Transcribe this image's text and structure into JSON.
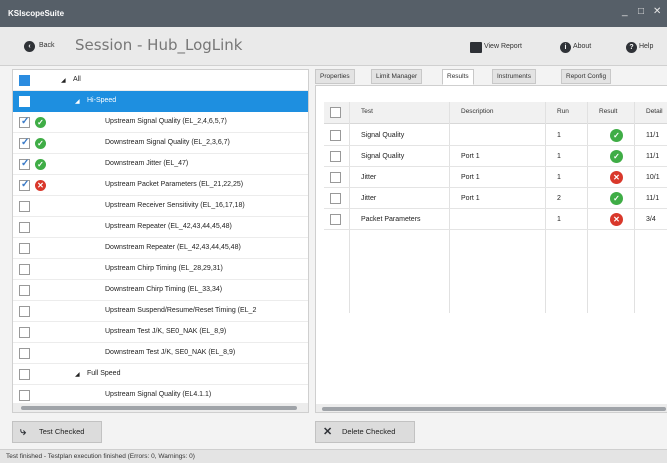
{
  "window": {
    "title": "KSIscopeSuite",
    "minimize": "_",
    "maximize": "□",
    "close": "✕"
  },
  "toolbar": {
    "back_label": "Back",
    "session_title": "Session - Hub_LogLink",
    "view_report": "View Report",
    "about": "About",
    "help": "Help"
  },
  "tree": {
    "root_label": "All",
    "group_label": "Hi-Speed",
    "items": [
      {
        "label": "Upstream Signal Quality (EL_2,4,6,5,7)",
        "checked": true,
        "status": "pass"
      },
      {
        "label": "Downstream Signal Quality (EL_2,3,6,7)",
        "checked": true,
        "status": "pass"
      },
      {
        "label": "Downstream Jitter (EL_47)",
        "checked": true,
        "status": "pass"
      },
      {
        "label": "Upstream Packet Parameters (EL_21,22,25)",
        "checked": true,
        "status": "fail"
      },
      {
        "label": "Upstream Receiver Sensitivity (EL_16,17,18)",
        "checked": false,
        "status": ""
      },
      {
        "label": "Upstream Repeater (EL_42,43,44,45,48)",
        "checked": false,
        "status": ""
      },
      {
        "label": "Downstream Repeater (EL_42,43,44,45,48)",
        "checked": false,
        "status": ""
      },
      {
        "label": "Upstream Chirp Timing (EL_28,29,31)",
        "checked": false,
        "status": ""
      },
      {
        "label": "Downstream Chirp Timing (EL_33,34)",
        "checked": false,
        "status": ""
      },
      {
        "label": "Upstream Suspend/Resume/Reset Timing (EL_2",
        "checked": false,
        "status": ""
      },
      {
        "label": "Upstream Test J/K, SE0_NAK (EL_8,9)",
        "checked": false,
        "status": ""
      },
      {
        "label": "Downstream Test J/K, SE0_NAK (EL_8,9)",
        "checked": false,
        "status": ""
      }
    ],
    "group2_label": "Full Speed",
    "group2_items": [
      {
        "label": "Upstream Signal Quality (EL4.1.1)",
        "checked": false,
        "status": ""
      }
    ]
  },
  "tabs": [
    "Properties",
    "Limit Manager",
    "Results",
    "Instruments",
    "Report Config"
  ],
  "active_tab": "Results",
  "results": {
    "columns": [
      "Test",
      "Description",
      "Run",
      "Result",
      "Detail"
    ],
    "rows": [
      {
        "test": "Signal Quality",
        "description": "",
        "run": "1",
        "result": "pass",
        "detail": "11/1"
      },
      {
        "test": "Signal Quality",
        "description": "Port 1",
        "run": "1",
        "result": "pass",
        "detail": "11/1"
      },
      {
        "test": "Jitter",
        "description": "Port 1",
        "run": "1",
        "result": "fail",
        "detail": "10/1"
      },
      {
        "test": "Jitter",
        "description": "Port 1",
        "run": "2",
        "result": "pass",
        "detail": "11/1"
      },
      {
        "test": "Packet Parameters",
        "description": "",
        "run": "1",
        "result": "fail",
        "detail": "3/4"
      }
    ]
  },
  "buttons": {
    "test_checked": "Test Checked",
    "delete_checked": "Delete Checked"
  },
  "status_text": "Test finished - Testplan execution finished (Errors: 0, Warnings: 0)",
  "colors": {
    "selection": "#1e8fe0",
    "pass": "#3fad46",
    "fail": "#d9382b",
    "titlebar": "#565f68"
  },
  "icons": {
    "pass": "check-circle-icon",
    "fail": "x-circle-icon"
  }
}
